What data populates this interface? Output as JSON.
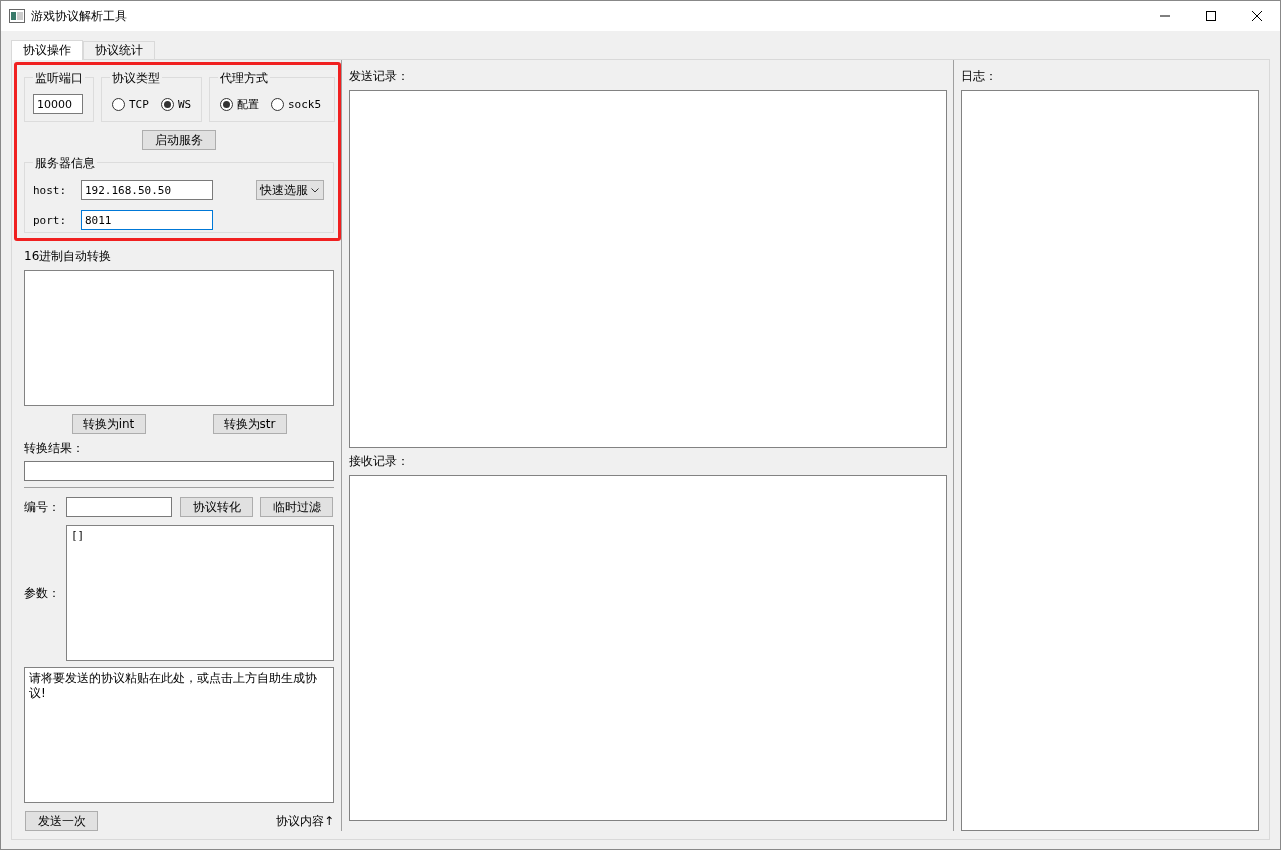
{
  "window": {
    "title": "游戏协议解析工具"
  },
  "tabs": [
    {
      "label": "协议操作",
      "selected": true
    },
    {
      "label": "协议统计",
      "selected": false
    }
  ],
  "listen_port": {
    "title": "监听端口",
    "value": "10000"
  },
  "protocol_type": {
    "title": "协议类型",
    "options": [
      {
        "label": "TCP",
        "selected": false
      },
      {
        "label": "WS",
        "selected": true
      }
    ]
  },
  "proxy_mode": {
    "title": "代理方式",
    "options": [
      {
        "label": "配置",
        "selected": true
      },
      {
        "label": "sock5",
        "selected": false
      }
    ]
  },
  "start_button": "启动服务",
  "server_info": {
    "title": "服务器信息",
    "host_label": "host:",
    "host_value": "192.168.50.50",
    "port_label": "port:",
    "port_value": "8011",
    "quick_select": "快速选服"
  },
  "hex_convert": {
    "title": "16进制自动转换",
    "buttons": [
      "转换为int",
      "转换为str"
    ],
    "result_label": "转换结果："
  },
  "protocol": {
    "id_label": "编号：",
    "buttons": [
      "协议转化",
      "临时过滤"
    ],
    "params_label": "参数：",
    "params_value": "[]",
    "content_value": "请将要发送的协议粘贴在此处，或点击上方自助生成协议!",
    "send_button": "发送一次",
    "content_label": "协议内容↑"
  },
  "send_log": {
    "title": "发送记录："
  },
  "receive_log": {
    "title": "接收记录："
  },
  "log": {
    "title": "日志："
  }
}
